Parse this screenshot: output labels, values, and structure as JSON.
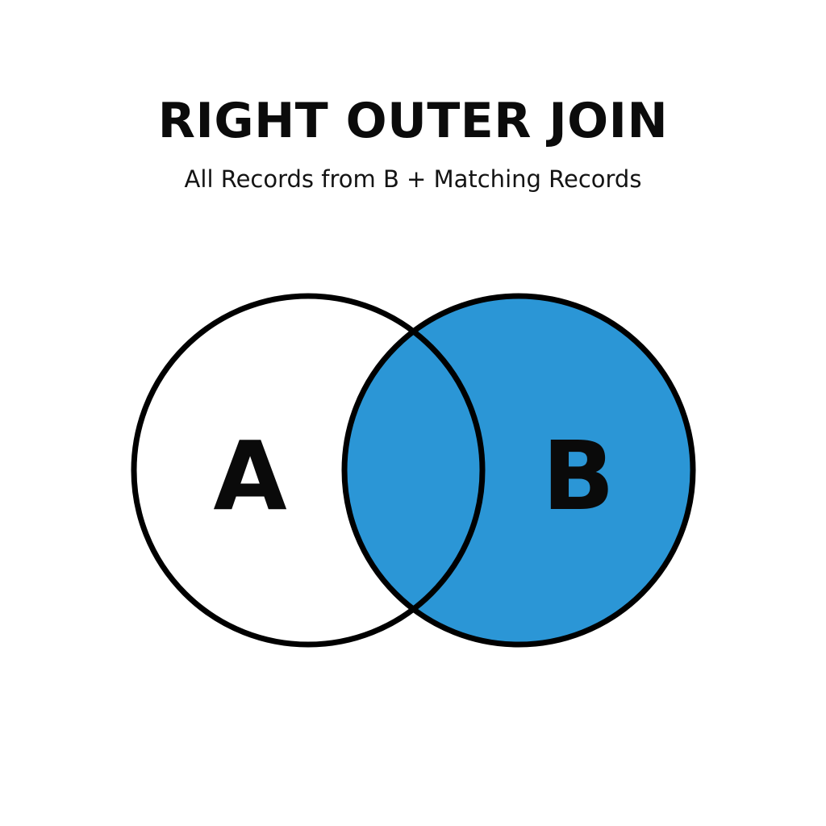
{
  "diagram": {
    "title": "RIGHT OUTER JOIN",
    "subtitle": "All Records from B + Matching Records",
    "set_a_label": "A",
    "set_b_label": "B"
  },
  "colors": {
    "fill": "#2b96d6",
    "outline": "#000000",
    "background": "#ffffff"
  }
}
